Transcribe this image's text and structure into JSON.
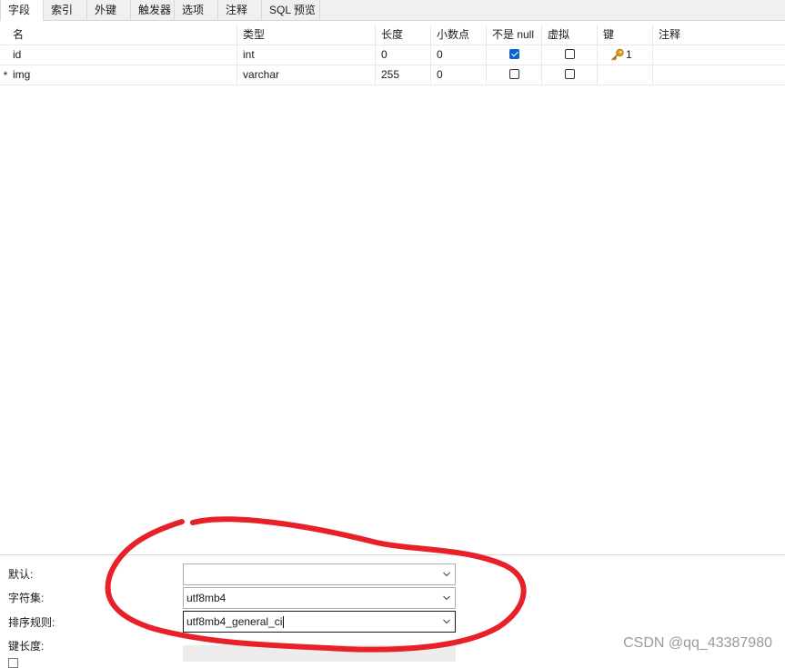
{
  "tabs": [
    "字段",
    "索引",
    "外键",
    "触发器",
    "选项",
    "注释",
    "SQL 预览"
  ],
  "columns": {
    "name": "名",
    "type": "类型",
    "length": "长度",
    "decimals": "小数点",
    "not_null": "不是 null",
    "virtual": "虚拟",
    "key": "键",
    "comment": "注释"
  },
  "fields": [
    {
      "marker": "",
      "name": "id",
      "type": "int",
      "length": "0",
      "decimals": "0",
      "not_null": true,
      "virtual": false,
      "key": "1",
      "comment": ""
    },
    {
      "marker": "*",
      "name": "img",
      "type": "varchar",
      "length": "255",
      "decimals": "0",
      "not_null": false,
      "virtual": false,
      "key": "",
      "comment": ""
    }
  ],
  "properties": {
    "default_label": "默认:",
    "default_value": "",
    "charset_label": "字符集:",
    "charset_value": "utf8mb4",
    "collation_label": "排序规则:",
    "collation_value": "utf8mb4_general_ci",
    "key_length_label": "键长度:"
  },
  "icons": {
    "primary_key": "key-icon",
    "dropdown": "chevron-down-icon"
  },
  "colors": {
    "checkbox_checked": "#0a63c9",
    "key_icon": "#e2a21a",
    "annotation": "#e8202a"
  },
  "watermark": "CSDN @qq_43387980"
}
